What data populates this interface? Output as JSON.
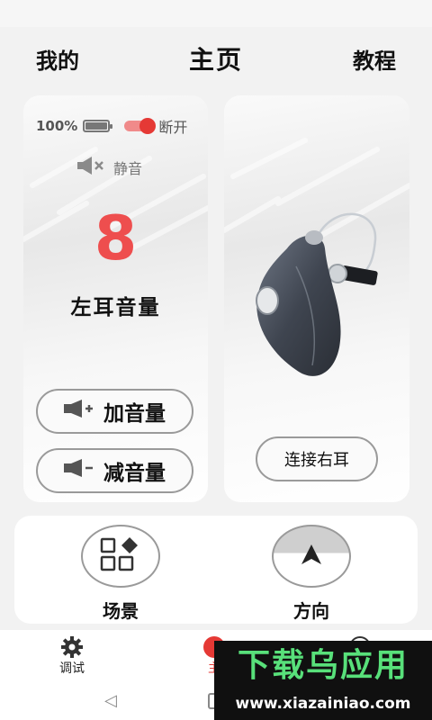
{
  "header": {
    "left": "我的",
    "title": "主页",
    "right": "教程"
  },
  "left_card": {
    "battery": "100%",
    "battery_level": 1.0,
    "toggle_label": "断开",
    "toggle_on": true,
    "mute_label": "静音",
    "volume_value": "8",
    "volume_label": "左耳音量",
    "volume_up": "加音量",
    "volume_down": "减音量"
  },
  "right_card": {
    "connect_button": "连接右耳"
  },
  "bottom": {
    "scene_label": "场景",
    "direction_label": "方向"
  },
  "tabbar": {
    "debug": "调试",
    "home": "主",
    "mine": ""
  },
  "watermark": {
    "main": "下载乌应用",
    "url": "www.xiazainiao.com"
  },
  "colors": {
    "accent": "#e53935",
    "volume_number": "#ee4e4e",
    "watermark_green": "#58e07a"
  },
  "icons": {
    "mute": "speaker-mute-icon",
    "volume_up": "speaker-plus-icon",
    "volume_down": "speaker-minus-icon",
    "scene": "grid-diamond-icon",
    "direction": "arrow-up-icon",
    "debug": "gear-icon"
  }
}
